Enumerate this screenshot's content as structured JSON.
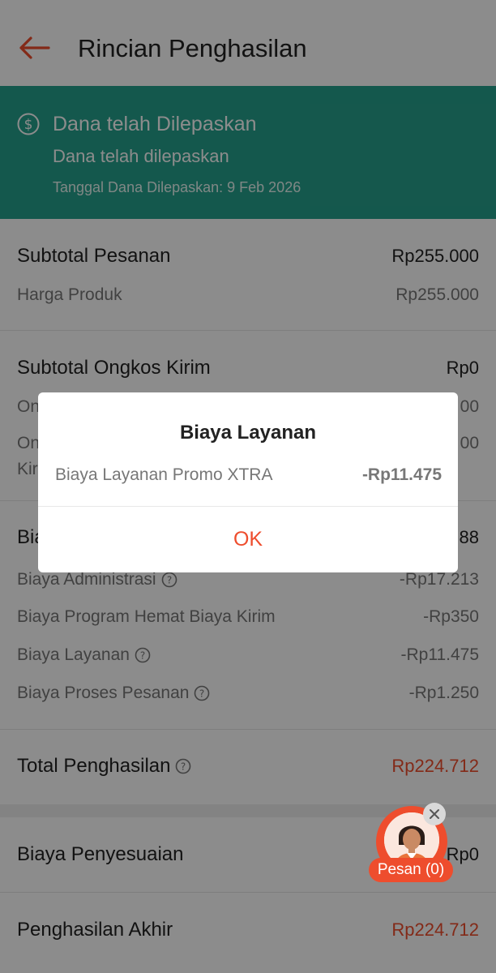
{
  "header": {
    "title": "Rincian Penghasilan",
    "back_icon": "arrow-left-icon",
    "accent": "#ee4d2d"
  },
  "banner": {
    "icon": "dollar-circle-icon",
    "title": "Dana telah Dilepaskan",
    "subtitle": "Dana telah dilepaskan",
    "date": "Tanggal Dana Dilepaskan: 9 Feb 2026",
    "color": "#26a08c"
  },
  "subtotal_pesanan": {
    "label": "Subtotal Pesanan",
    "value": "Rp255.000",
    "items": [
      {
        "label": "Harga Produk",
        "value": "Rp255.000"
      }
    ]
  },
  "subtotal_ongkir": {
    "label": "Subtotal Ongkos Kirim",
    "value": "Rp0",
    "items": [
      {
        "label": "On",
        "value": "00"
      },
      {
        "label": "On",
        "label2": "Kir",
        "value": "00"
      }
    ]
  },
  "biaya": {
    "label": "Bia",
    "value": "88",
    "items": [
      {
        "label": "Biaya Administrasi",
        "value": "-Rp17.213"
      },
      {
        "label": "Biaya Program Hemat Biaya Kirim",
        "value": "-Rp350"
      },
      {
        "label": "Biaya Layanan",
        "value": "-Rp11.475"
      },
      {
        "label": "Biaya Proses Pesanan",
        "value": "-Rp1.250"
      }
    ]
  },
  "total": {
    "label": "Total Penghasilan",
    "value": "Rp224.712"
  },
  "penyesuaian": {
    "label": "Biaya Penyesuaian",
    "value": "Rp0"
  },
  "akhir": {
    "label": "Penghasilan Akhir",
    "value": "Rp224.712"
  },
  "modal": {
    "title": "Biaya Layanan",
    "row_label": "Biaya Layanan Promo XTRA",
    "row_value": "-Rp11.475",
    "ok_label": "OK"
  },
  "chat": {
    "label": "Pesan (0)",
    "close_icon": "close-icon",
    "avatar": "agent-avatar"
  }
}
